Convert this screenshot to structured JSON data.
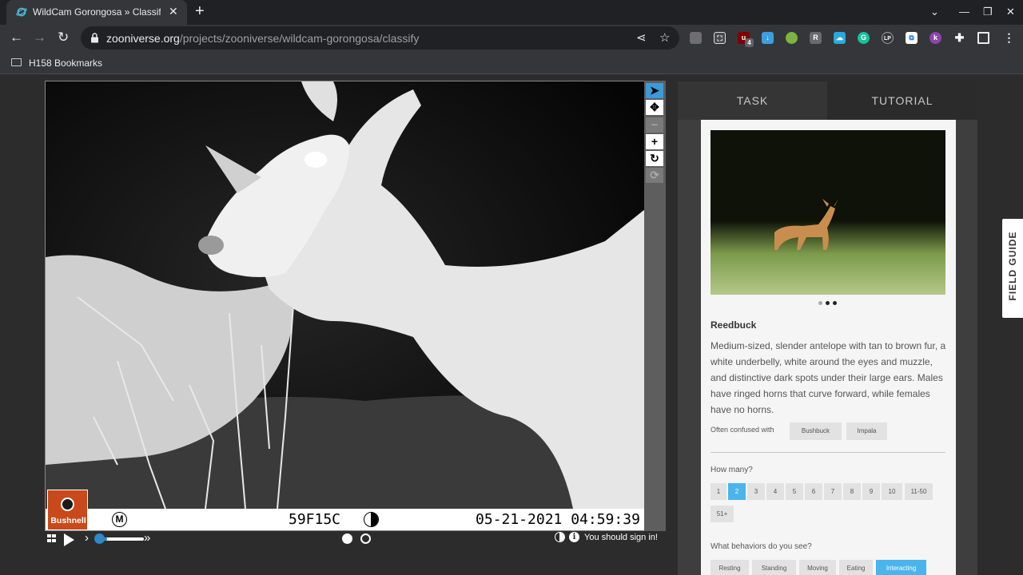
{
  "browser": {
    "tab_title": "WildCam Gorongosa » Classify",
    "url_host": "zooniverse.org",
    "url_path": "/projects/zooniverse/wildcam-gorongosa/classify",
    "bookmark_label": "H158 Bookmarks",
    "extension_badge": "4",
    "extensions": [
      "copy-icon",
      "scan-icon",
      "adblock-icon",
      "download-icon",
      "globe-icon",
      "r-icon",
      "cloud-icon",
      "grammarly-icon",
      "lp-icon",
      "bracket-icon",
      "k-icon",
      "puzzle-icon",
      "sidepanel-icon",
      "menu-icon"
    ]
  },
  "viewer": {
    "camera_brand": "Bushnell",
    "camera_mode": "M",
    "camera_id": "59F15C",
    "timestamp": "05-21-2021  04:59:39",
    "tools": [
      "pointer-icon",
      "pan-icon",
      "zoom-out-icon",
      "zoom-in-icon",
      "rotate-icon",
      "reset-icon"
    ],
    "signin_text": "You should sign in!",
    "frames": 2,
    "current_frame": 1
  },
  "panel": {
    "tab_task": "TASK",
    "tab_tutorial": "TUTORIAL",
    "species": {
      "name": "Reedbuck",
      "description": "Medium-sized, slender antelope with tan to brown fur, a white underbelly, white around the eyes and muzzle, and distinctive dark spots under their large ears. Males have ringed horns that curve forward, while females have no horns.",
      "confused_label": "Often confused with",
      "confused_with": [
        "Bushbuck",
        "Impala"
      ]
    },
    "how_many": {
      "label": "How many?",
      "options": [
        "1",
        "2",
        "3",
        "4",
        "5",
        "6",
        "7",
        "8",
        "9",
        "10",
        "11-50",
        "51+"
      ],
      "selected": "2"
    },
    "behaviors": {
      "label": "What behaviors do you see?",
      "options": [
        "Resting",
        "Standing",
        "Moving",
        "Eating",
        "Interacting"
      ],
      "selected": "Interacting"
    },
    "field_guide": "FIELD GUIDE"
  }
}
